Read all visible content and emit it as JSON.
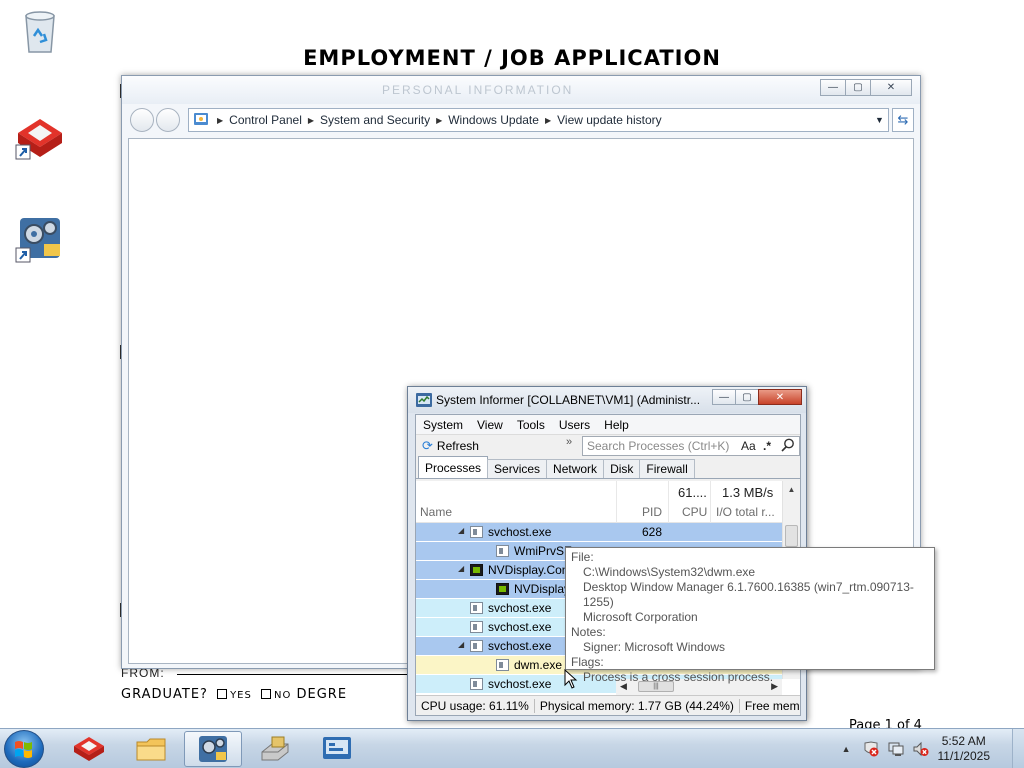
{
  "document": {
    "title": "EMPLOYMENT / JOB APPLICATION",
    "ghost_header": "PERSONAL INFORMATION",
    "from_label": "FROM:",
    "graduate_label": "GRADUATE?",
    "yes_label": "YES",
    "no_label": "NO",
    "degree_label": "DEGRE",
    "page_label": "Page 1 of 4"
  },
  "explorer": {
    "breadcrumb": [
      "Control Panel",
      "System and Security",
      "Windows Update",
      "View update history"
    ]
  },
  "system_informer": {
    "title": "System Informer [COLLABNET\\VM1] (Administr...",
    "menu": [
      "System",
      "View",
      "Tools",
      "Users",
      "Help"
    ],
    "toolbar": {
      "refresh_label": "Refresh",
      "search_placeholder": "Search Processes (Ctrl+K)",
      "case_label": "Aa",
      "regex_label": ".*"
    },
    "tabs": [
      "Processes",
      "Services",
      "Network",
      "Disk",
      "Firewall"
    ],
    "active_tab": "Processes",
    "columns": {
      "name": "Name",
      "pid": "PID",
      "cpu": "CPU",
      "io": "I/O total r...",
      "cpu_total": "61....",
      "io_total": "1.3 MB/s"
    },
    "rows": [
      {
        "name": "svchost.exe",
        "pid": "628",
        "indent": 1,
        "expanded": true,
        "icon": "window-icon",
        "bg": "#a9c8ef"
      },
      {
        "name": "WmiPrvSE.exe",
        "pid": "",
        "indent": 2,
        "expanded": false,
        "icon": "window-icon",
        "bg": "#a9c8ef"
      },
      {
        "name": "NVDisplay.Container.exe",
        "pid": "",
        "indent": 1,
        "expanded": true,
        "icon": "nvidia-icon",
        "bg": "#a9c8ef"
      },
      {
        "name": "NVDisplay.Container.exe",
        "pid": "",
        "indent": 2,
        "expanded": false,
        "icon": "nvidia-icon",
        "bg": "#a9c8ef"
      },
      {
        "name": "svchost.exe",
        "pid": "",
        "indent": 1,
        "expanded": false,
        "icon": "window-icon",
        "bg": "#cdeefa"
      },
      {
        "name": "svchost.exe",
        "pid": "",
        "indent": 1,
        "expanded": false,
        "icon": "window-icon",
        "bg": "#cdeefa"
      },
      {
        "name": "svchost.exe",
        "pid": "",
        "indent": 1,
        "expanded": true,
        "icon": "window-icon",
        "bg": "#a9c8ef"
      },
      {
        "name": "dwm.exe",
        "pid": "",
        "indent": 2,
        "expanded": false,
        "icon": "window-icon",
        "bg": "#fbf5c6"
      },
      {
        "name": "svchost.exe",
        "pid": "",
        "indent": 1,
        "expanded": false,
        "icon": "window-icon",
        "bg": "#cdeefa"
      }
    ],
    "status": {
      "cpu": "CPU usage: 61.11%",
      "memory": "Physical memory: 1.77 GB (44.24%)",
      "free": "Free memo"
    }
  },
  "tooltip": {
    "file_label": "File:",
    "path": "C:\\Windows\\System32\\dwm.exe",
    "description": "Desktop Window Manager 6.1.7600.16385 (win7_rtm.090713-1255)",
    "company": "Microsoft Corporation",
    "notes_label": "Notes:",
    "signer": "Signer: Microsoft Windows",
    "flags_label": "Flags:",
    "flags": "Process is a cross session process."
  },
  "taskbar": {
    "time": "5:52 AM",
    "date": "11/1/2025"
  },
  "colors": {
    "selection_blue": "#a9c8ef",
    "service_cyan": "#cdeefa",
    "highlight_yellow": "#fbf5c6"
  }
}
